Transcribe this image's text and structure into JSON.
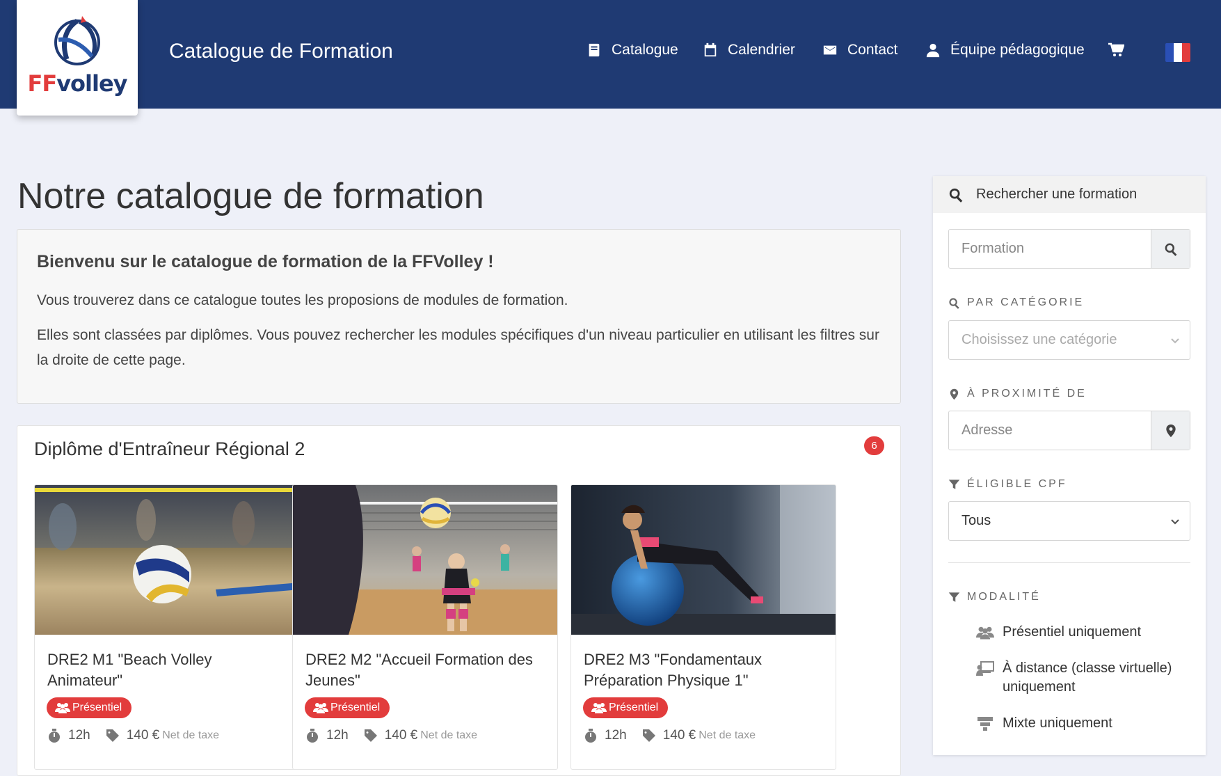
{
  "header": {
    "logo_text_ff": "FF",
    "logo_text_volley": "volley",
    "site_title": "Catalogue de Formation",
    "nav": [
      {
        "label": "Catalogue",
        "icon": "book-icon"
      },
      {
        "label": "Calendrier",
        "icon": "calendar-icon"
      },
      {
        "label": "Contact",
        "icon": "envelope-icon"
      },
      {
        "label": "Équipe pédagogique",
        "icon": "user-icon"
      }
    ],
    "cart_icon": "cart-icon",
    "language_flag": "french-flag-icon"
  },
  "main": {
    "page_title": "Notre catalogue de formation",
    "welcome": {
      "heading": "Bienvenu sur le catalogue de formation de la FFVolley !",
      "paragraph1": "Vous trouverez dans ce catalogue toutes les proposions de modules de formation.",
      "paragraph2": "Elles sont classées par diplômes. Vous pouvez rechercher les modules spécifiques d'un niveau particulier en utilisant les filtres sur la droite de cette page."
    },
    "diploma": {
      "title": "Diplôme d'Entraîneur Régional 2",
      "count": "6",
      "cards": [
        {
          "title": "DRE2 M1 \"Beach Volley Animateur\"",
          "badge": "Présentiel",
          "duration": "12h",
          "price": "140 €",
          "price_note": "Net de taxe",
          "image": "beach-volleyball-photo"
        },
        {
          "title": "DRE2 M2 \"Accueil Formation des Jeunes\"",
          "badge": "Présentiel",
          "duration": "12h",
          "price": "140 €",
          "price_note": "Net de taxe",
          "image": "youth-volleyball-photo"
        },
        {
          "title": "DRE2 M3 \"Fondamentaux Préparation Physique 1\"",
          "badge": "Présentiel",
          "duration": "12h",
          "price": "140 €",
          "price_note": "Net de taxe",
          "image": "fitness-ball-photo"
        }
      ]
    }
  },
  "sidebar": {
    "heading": "Rechercher une formation",
    "search_placeholder": "Formation",
    "category_label": "PAR CATÉGORIE",
    "category_placeholder": "Choisissez une catégorie",
    "proximity_label": "À PROXIMITÉ DE",
    "address_placeholder": "Adresse",
    "cpf_label": "ÉLIGIBLE CPF",
    "cpf_value": "Tous",
    "modality_label": "MODALITÉ",
    "modalities": [
      {
        "label": "Présentiel uniquement",
        "icon": "users-icon"
      },
      {
        "label": "À distance (classe virtuelle) uniquement",
        "icon": "remote-class-icon"
      },
      {
        "label": "Mixte uniquement",
        "icon": "mixed-icon"
      }
    ]
  },
  "colors": {
    "header_bg": "#1f3a73",
    "accent_red": "#e23c3c",
    "page_bg": "#eef0f8"
  }
}
